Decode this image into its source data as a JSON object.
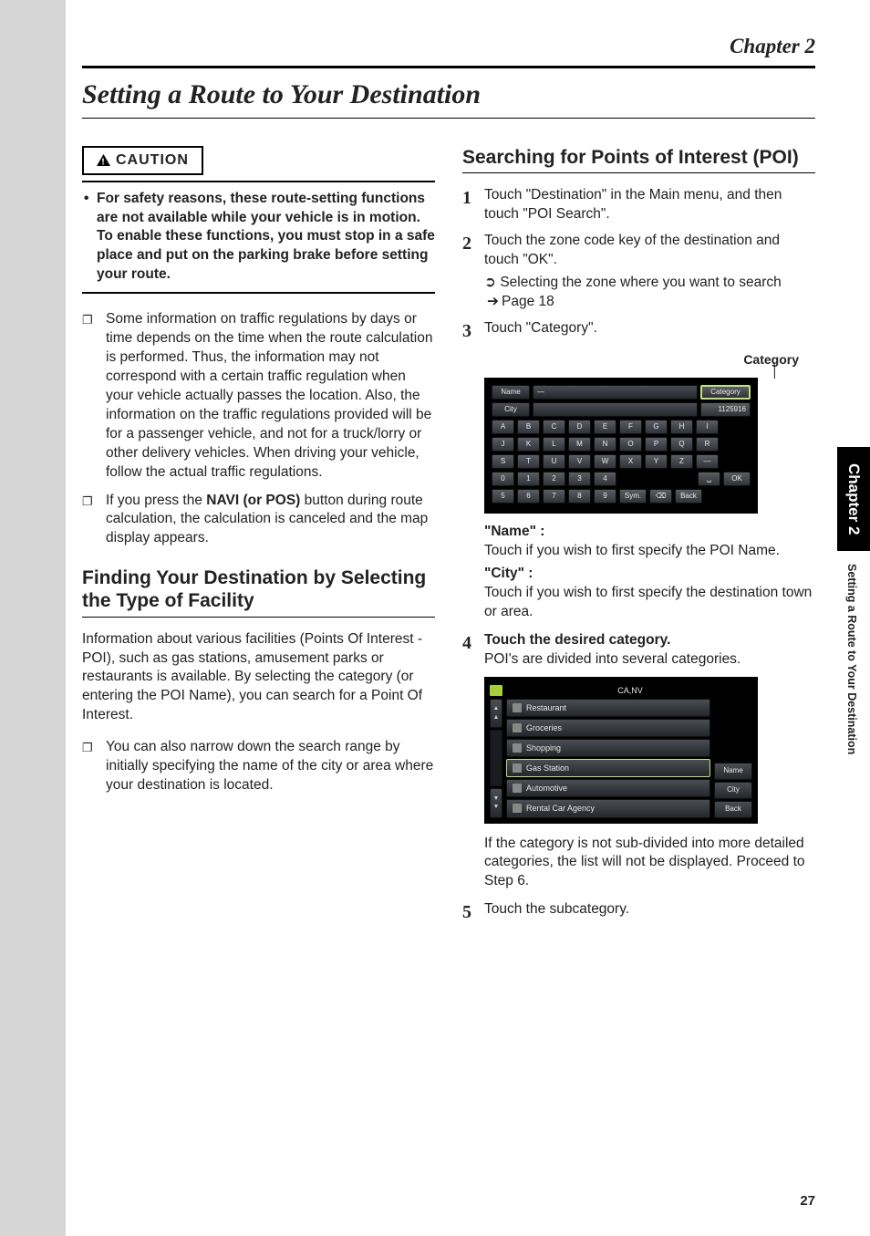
{
  "chapter_top": "Chapter 2",
  "page_title": "Setting a Route to Your Destination",
  "caution": {
    "label": "CAUTION",
    "text": "For safety reasons, these route-setting functions are not available while your vehicle is in motion. To enable these functions, you must stop in a safe place and put on the parking brake before setting your route."
  },
  "left_bullets": [
    "Some information on traffic regulations by days or time depends on the time when the route calculation is performed. Thus, the information may not correspond with a certain traffic regulation when your vehicle actually passes the location. Also, the information on the traffic regulations provided will be for a passenger vehicle, and not for a truck/lorry or other delivery vehicles. When driving your vehicle, follow the actual traffic regulations."
  ],
  "navi_bullet": {
    "pre": "If you press the ",
    "bold": "NAVI (or POS)",
    "post": " button during route calculation, the calculation is canceled and the map display appears."
  },
  "h2_left": "Finding Your Destination by Selecting the Type of Facility",
  "left_para": "Information about various facilities (Points Of Interest - POI), such as gas stations, amusement parks or restaurants is available. By selecting the category (or entering the POI Name), you can search for a Point Of Interest.",
  "left_bullet2": "You can also narrow down the search range by initially specifying the name of the city or area where your destination is located.",
  "h2_right": "Searching for Points of Interest (POI)",
  "steps": {
    "s1": "Touch \"Destination\" in the Main menu, and then touch \"POI Search\".",
    "s2": "Touch the zone code key of the destination and touch \"OK\".",
    "s2sub_pre": "Selecting the zone where you want to search ",
    "s2sub_ref": "Page 18",
    "s3": "Touch \"Category\".",
    "s4": "Touch the desired category.",
    "s4note": "POI's are divided into several categories.",
    "s4after": "If the category is not sub-divided into more detailed categories, the list will not be displayed. Proceed to Step 6.",
    "s5": "Touch the subcategory."
  },
  "category_label": "Category",
  "keyboard": {
    "name_btn": "Name",
    "city_btn": "City",
    "category_btn": "Category",
    "count": "1125916",
    "rows": [
      [
        "A",
        "B",
        "C",
        "D",
        "E",
        "F",
        "G",
        "H",
        "I"
      ],
      [
        "J",
        "K",
        "L",
        "M",
        "N",
        "O",
        "P",
        "Q",
        "R"
      ],
      [
        "S",
        "T",
        "U",
        "V",
        "W",
        "X",
        "Y",
        "Z",
        "—"
      ],
      [
        "0",
        "1",
        "2",
        "3",
        "4"
      ],
      [
        "5",
        "6",
        "7",
        "8",
        "9"
      ]
    ],
    "ok": "OK",
    "sym": "Sym.",
    "del": "⌫",
    "back": "Back"
  },
  "desc_name_h": "\"Name\" :",
  "desc_name": "Touch if you wish to first specify the POI Name.",
  "desc_city_h": "\"City\" :",
  "desc_city": "Touch if you wish to first specify the destination town or area.",
  "catlist": {
    "header": "CA,NV",
    "items": [
      "Restaurant",
      "Groceries",
      "Shopping",
      "Gas Station",
      "Automotive",
      "Rental Car Agency"
    ],
    "side": [
      "Name",
      "City",
      "Back"
    ]
  },
  "side_tab_dark": "Chapter 2",
  "side_tab_light": "Setting a Route to Your Destination",
  "page_num": "27"
}
